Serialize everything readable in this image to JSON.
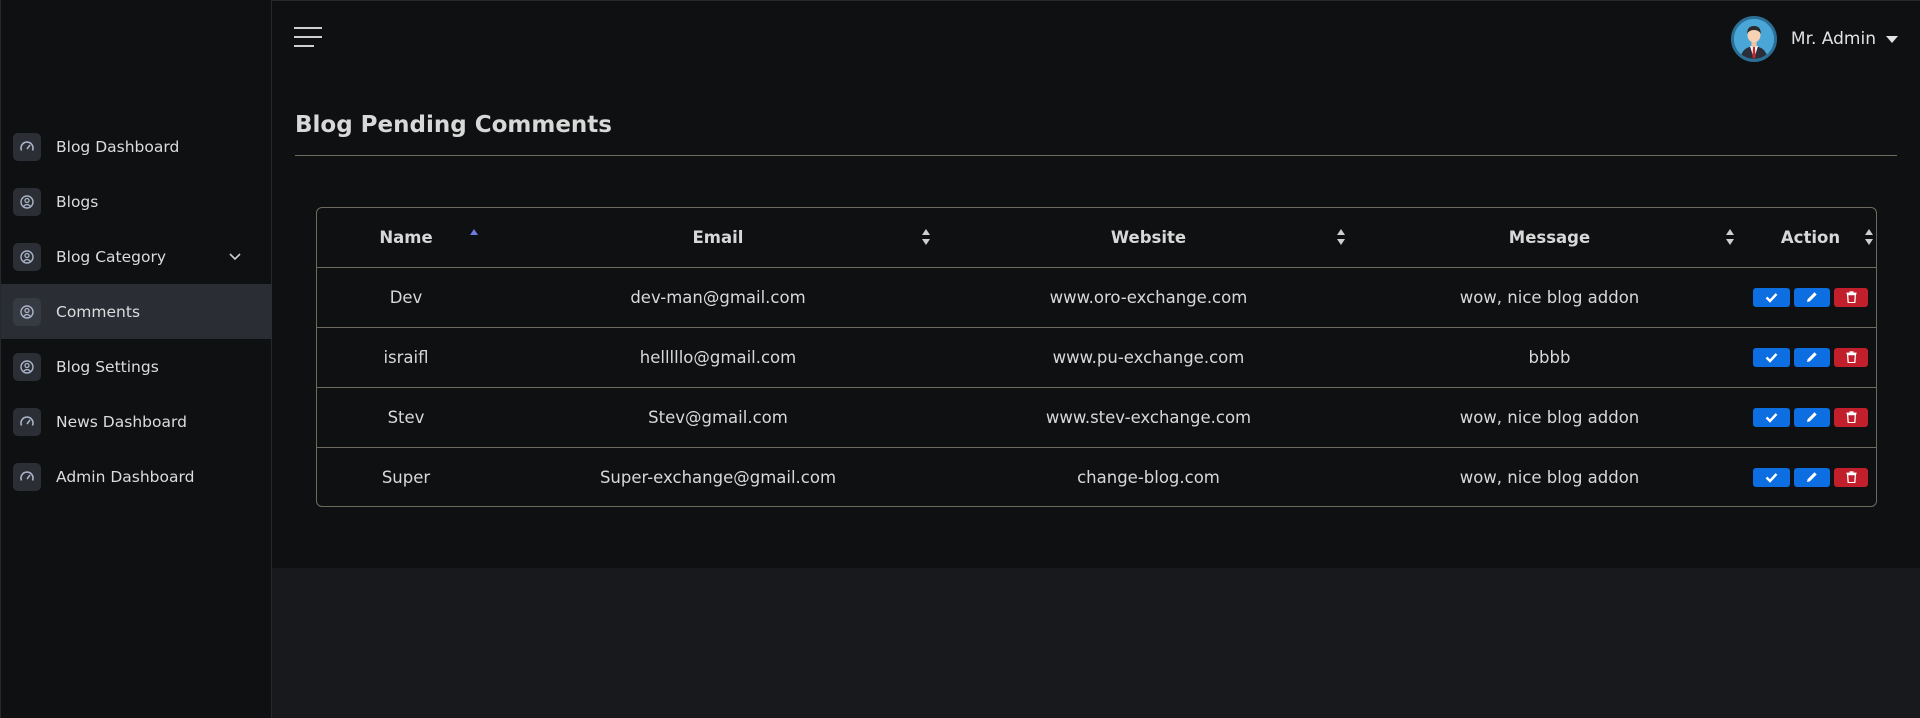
{
  "sidebar": {
    "items": [
      {
        "label": "Blog Dashboard",
        "icon": "dashboard-icon"
      },
      {
        "label": "Blogs",
        "icon": "user-circle-icon"
      },
      {
        "label": "Blog Category",
        "icon": "user-circle-icon"
      },
      {
        "label": "Comments",
        "icon": "user-circle-icon"
      },
      {
        "label": "Blog Settings",
        "icon": "user-circle-icon"
      },
      {
        "label": "News Dashboard",
        "icon": "dashboard-icon"
      },
      {
        "label": "Admin Dashboard",
        "icon": "dashboard-icon"
      }
    ],
    "active_index": 3
  },
  "header": {
    "user_name": "Mr. Admin"
  },
  "page": {
    "title": "Blog Pending Comments"
  },
  "table": {
    "columns": [
      "Name",
      "Email",
      "Website",
      "Message",
      "Action"
    ],
    "rows": [
      {
        "name": "Dev",
        "email": "dev-man@gmail.com",
        "website": "www.oro-exchange.com",
        "message": "wow, nice blog addon"
      },
      {
        "name": "israifl",
        "email": "helllllo@gmail.com",
        "website": "www.pu-exchange.com",
        "message": "bbbb"
      },
      {
        "name": "Stev",
        "email": "Stev@gmail.com",
        "website": "www.stev-exchange.com",
        "message": "wow, nice blog addon"
      },
      {
        "name": "Super",
        "email": "Super-exchange@gmail.com",
        "website": "change-blog.com",
        "message": "wow, nice blog addon"
      }
    ]
  },
  "colors": {
    "approve": "#0c6ee0",
    "edit": "#0c6ee0",
    "delete": "#c21f2d",
    "sort_active": "#6b7be0"
  }
}
